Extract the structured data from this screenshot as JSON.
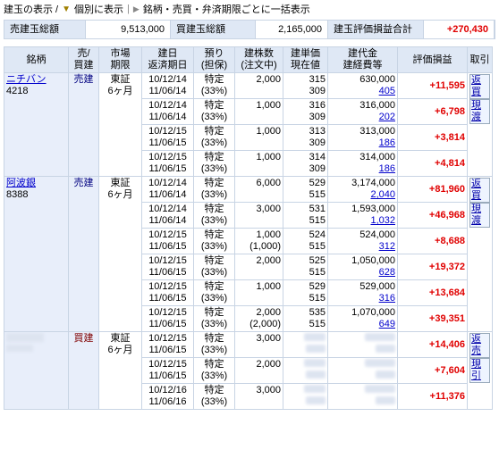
{
  "header": {
    "label_display": "建玉の表示 /",
    "label_individual": "個別に表示",
    "label_sep": "|",
    "label_bulk": "銘柄・売買・弁済期限ごとに一括表示"
  },
  "summary": {
    "sell_label": "売建玉総額",
    "sell_value": "9,513,000",
    "buy_label": "買建玉総額",
    "buy_value": "2,165,000",
    "pl_label": "建玉評価損益合計",
    "pl_value": "+270,430"
  },
  "columns": {
    "c1": "銘柄",
    "c2a": "売/",
    "c2b": "買建",
    "c3a": "市場",
    "c3b": "期限",
    "c4a": "建日",
    "c4b": "返済期日",
    "c5a": "預り",
    "c5b": "(担保)",
    "c6a": "建株数",
    "c6b": "(注文中)",
    "c7a": "建単価",
    "c7b": "現在値",
    "c8a": "建代金",
    "c8b": "建経費等",
    "c9": "評価損益",
    "c10": "取引"
  },
  "groups": [
    {
      "name": "ニチバン",
      "code": "4218",
      "side": "売建",
      "market": "東証",
      "term": "6ヶ月",
      "actions": [
        "返買",
        "現渡"
      ],
      "rows": [
        {
          "d1": "10/12/14",
          "d2": "11/06/14",
          "a1": "特定",
          "a2": "(33%)",
          "qty": "2,000",
          "ord": "",
          "p1": "315",
          "p2": "309",
          "amt": "630,000",
          "fee": "405",
          "pl": "+11,595"
        },
        {
          "d1": "10/12/14",
          "d2": "11/06/14",
          "a1": "特定",
          "a2": "(33%)",
          "qty": "1,000",
          "ord": "",
          "p1": "316",
          "p2": "309",
          "amt": "316,000",
          "fee": "202",
          "pl": "+6,798"
        },
        {
          "d1": "10/12/15",
          "d2": "11/06/15",
          "a1": "特定",
          "a2": "(33%)",
          "qty": "1,000",
          "ord": "",
          "p1": "313",
          "p2": "309",
          "amt": "313,000",
          "fee": "186",
          "pl": "+3,814"
        },
        {
          "d1": "10/12/15",
          "d2": "11/06/15",
          "a1": "特定",
          "a2": "(33%)",
          "qty": "1,000",
          "ord": "",
          "p1": "314",
          "p2": "309",
          "amt": "314,000",
          "fee": "186",
          "pl": "+4,814"
        }
      ]
    },
    {
      "name": "阿波銀",
      "code": "8388",
      "side": "売建",
      "market": "東証",
      "term": "6ヶ月",
      "actions": [
        "返買",
        "現渡"
      ],
      "rows": [
        {
          "d1": "10/12/14",
          "d2": "11/06/14",
          "a1": "特定",
          "a2": "(33%)",
          "qty": "6,000",
          "ord": "",
          "p1": "529",
          "p2": "515",
          "amt": "3,174,000",
          "fee": "2,040",
          "pl": "+81,960"
        },
        {
          "d1": "10/12/14",
          "d2": "11/06/14",
          "a1": "特定",
          "a2": "(33%)",
          "qty": "3,000",
          "ord": "",
          "p1": "531",
          "p2": "515",
          "amt": "1,593,000",
          "fee": "1,032",
          "pl": "+46,968"
        },
        {
          "d1": "10/12/15",
          "d2": "11/06/15",
          "a1": "特定",
          "a2": "(33%)",
          "qty": "1,000",
          "ord": "(1,000)",
          "p1": "524",
          "p2": "515",
          "amt": "524,000",
          "fee": "312",
          "pl": "+8,688"
        },
        {
          "d1": "10/12/15",
          "d2": "11/06/15",
          "a1": "特定",
          "a2": "(33%)",
          "qty": "2,000",
          "ord": "",
          "p1": "525",
          "p2": "515",
          "amt": "1,050,000",
          "fee": "628",
          "pl": "+19,372"
        },
        {
          "d1": "10/12/15",
          "d2": "11/06/15",
          "a1": "特定",
          "a2": "(33%)",
          "qty": "1,000",
          "ord": "",
          "p1": "529",
          "p2": "515",
          "amt": "529,000",
          "fee": "316",
          "pl": "+13,684"
        },
        {
          "d1": "10/12/15",
          "d2": "11/06/15",
          "a1": "特定",
          "a2": "(33%)",
          "qty": "2,000",
          "ord": "(2,000)",
          "p1": "535",
          "p2": "515",
          "amt": "1,070,000",
          "fee": "649",
          "pl": "+39,351"
        }
      ]
    },
    {
      "name": "",
      "code": "",
      "side": "買建",
      "market": "東証",
      "term": "6ヶ月",
      "actions": [
        "返売",
        "現引"
      ],
      "rows": [
        {
          "d1": "10/12/15",
          "d2": "11/06/15",
          "a1": "特定",
          "a2": "(33%)",
          "qty": "3,000",
          "ord": "",
          "p1": "",
          "p2": "",
          "amt": "",
          "fee": "",
          "pl": "+14,406"
        },
        {
          "d1": "10/12/15",
          "d2": "11/06/15",
          "a1": "特定",
          "a2": "(33%)",
          "qty": "2,000",
          "ord": "",
          "p1": "",
          "p2": "",
          "amt": "",
          "fee": "",
          "pl": "+7,604"
        },
        {
          "d1": "10/12/16",
          "d2": "11/06/16",
          "a1": "特定",
          "a2": "(33%)",
          "qty": "3,000",
          "ord": "",
          "p1": "",
          "p2": "",
          "amt": "",
          "fee": "",
          "pl": "+11,376"
        }
      ]
    }
  ]
}
